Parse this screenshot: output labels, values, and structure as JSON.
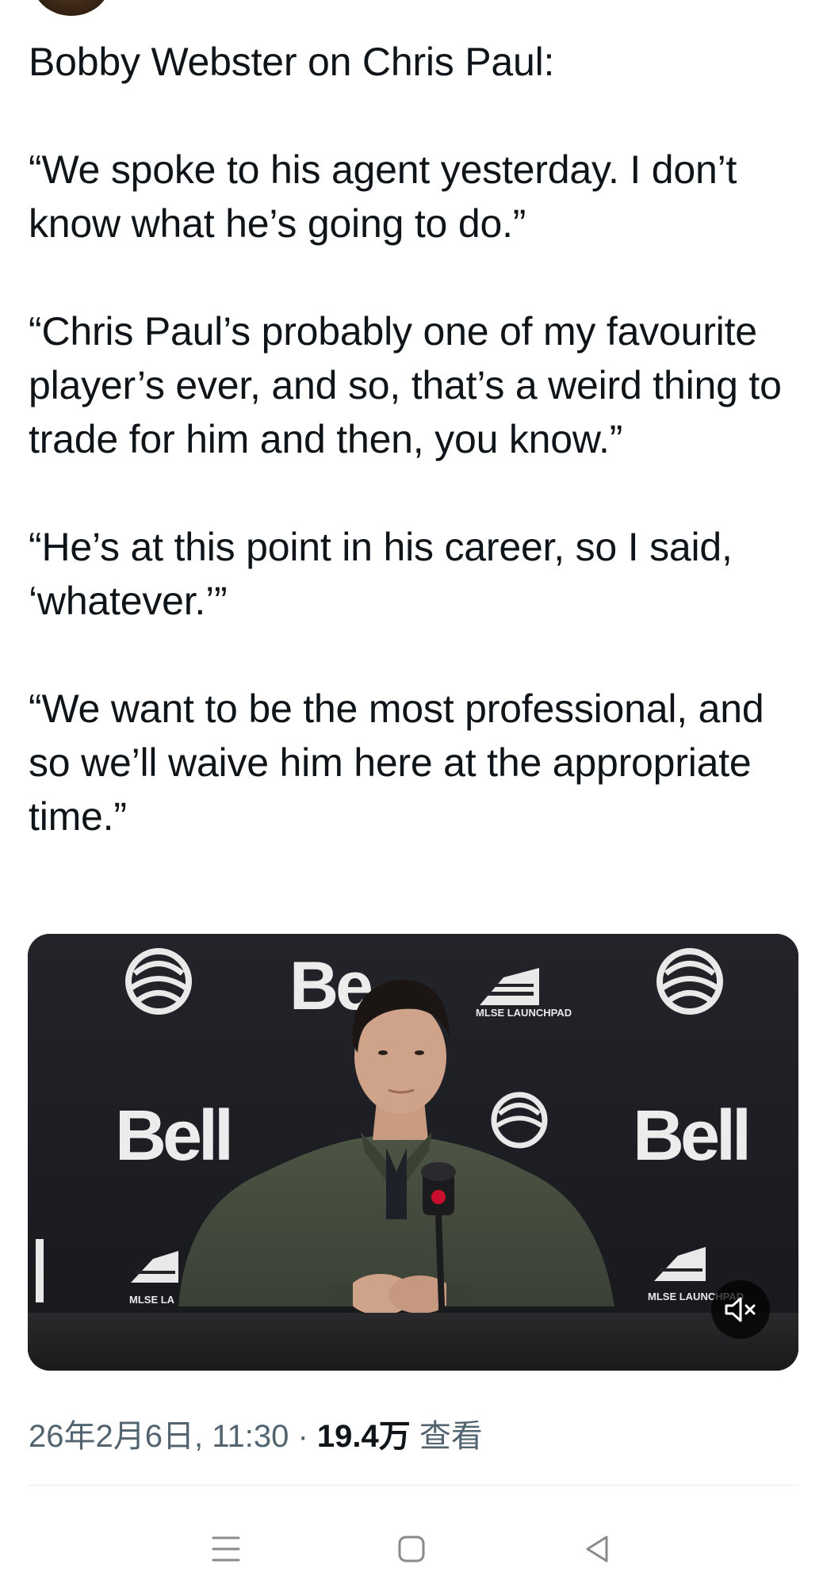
{
  "tweet": {
    "paragraphs": [
      "Bobby Webster on Chris Paul:",
      "“We spoke to his agent yesterday. I don’t know what he’s going to do.”",
      "“Chris Paul’s probably one of my favourite player’s ever, and so, that’s a weird thing to trade for him and then, you know.”",
      "“He’s at this point in his career, so I said, ‘whatever.’”",
      "“We want to be the most professional, and so we’ll waive him here at the appropriate time.”"
    ]
  },
  "media": {
    "kind": "video",
    "sponsor_text": "Bell",
    "sponsor_text_partial": "Be",
    "launchpad_text": "MLSE LAUNCHPAD",
    "launchpad_text_partial": "MLSE LA",
    "mute_icon": "speaker-muted-icon"
  },
  "meta": {
    "timestamp": "26年2月6日, 11:30",
    "separator": " · ",
    "views_count": "19.4万",
    "views_label": " 查看"
  },
  "navbar": {
    "icons": [
      "menu-icon",
      "home-square-icon",
      "back-triangle-icon"
    ]
  },
  "colors": {
    "text_primary": "#0f1419",
    "text_secondary": "#536471",
    "divider": "#e6ecf0",
    "backdrop": "#1c1d22"
  }
}
